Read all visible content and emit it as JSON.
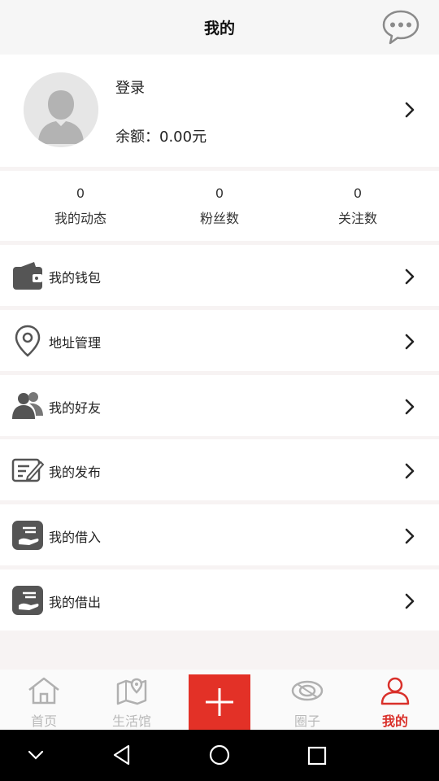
{
  "header": {
    "title": "我的",
    "message_icon": "chat-bubble-icon"
  },
  "profile": {
    "login_label": "登录",
    "balance_label": "余额：0.00元",
    "avatar_icon": "default-user-avatar"
  },
  "stats": [
    {
      "value": "0",
      "label": "我的动态"
    },
    {
      "value": "0",
      "label": "粉丝数"
    },
    {
      "value": "0",
      "label": "关注数"
    }
  ],
  "menu": [
    {
      "label": "我的钱包",
      "icon": "wallet-icon"
    },
    {
      "label": "地址管理",
      "icon": "location-pin-icon"
    },
    {
      "label": "我的好友",
      "icon": "friends-icon"
    },
    {
      "label": "我的发布",
      "icon": "edit-note-icon"
    },
    {
      "label": "我的借入",
      "icon": "borrow-in-icon"
    },
    {
      "label": "我的借出",
      "icon": "borrow-out-icon"
    }
  ],
  "tabbar": [
    {
      "label": "首页",
      "icon": "home-icon",
      "active": false
    },
    {
      "label": "生活馆",
      "icon": "map-icon",
      "active": false
    },
    {
      "label": "",
      "icon": "plus-icon",
      "active": false
    },
    {
      "label": "圈子",
      "icon": "eye-icon",
      "active": false
    },
    {
      "label": "我的",
      "icon": "user-icon",
      "active": true
    }
  ],
  "colors": {
    "accent": "#e33127",
    "active_text": "#d9302a",
    "inactive_text": "#b9b9b9",
    "icon_dark": "#555555"
  }
}
